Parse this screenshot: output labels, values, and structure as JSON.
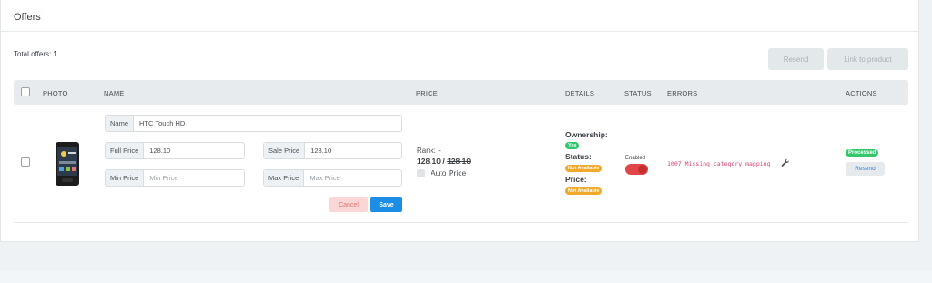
{
  "card": {
    "title": "Offers"
  },
  "summary": {
    "total_label": "Total offers:",
    "total_value": "1"
  },
  "toolbar": {
    "resend_label": "Resend",
    "link_label": "Link to product"
  },
  "table": {
    "headers": {
      "photo": "PHOTO",
      "name": "NAME",
      "price": "PRICE",
      "details": "DETAILS",
      "status": "STATUS",
      "errors": "ERRORS",
      "actions": "ACTIONS"
    }
  },
  "row": {
    "fields": {
      "name_label": "Name",
      "name_value": "HTC Touch HD",
      "full_price_label": "Full Price",
      "full_price_value": "128.10",
      "sale_price_label": "Sale Price",
      "sale_price_value": "128.10",
      "min_price_label": "Min Price",
      "min_price_placeholder": "Min Price",
      "max_price_label": "Max Price",
      "max_price_placeholder": "Max Price"
    },
    "cancel_label": "Cancel",
    "save_label": "Save",
    "price": {
      "rank": "Rank: -",
      "current": "128.10",
      "separator": " / ",
      "old": "128.10",
      "auto_label": "Auto Price"
    },
    "details": {
      "ownership_label": "Ownership:",
      "ownership_value": "Yes",
      "status_label": "Status:",
      "status_value": "Not Available",
      "price_label": "Price:",
      "price_value": "Not Available"
    },
    "status": {
      "label": "Enabled",
      "enabled": true
    },
    "error": {
      "text": "1007 Missing category mapping",
      "icon": "wrench-icon"
    },
    "actions": {
      "state": "Processed",
      "resend_label": "Resend"
    }
  },
  "colors": {
    "accent": "#1d8ee6",
    "success": "#34c66d",
    "warning": "#f0a92a",
    "danger": "#e14646"
  }
}
